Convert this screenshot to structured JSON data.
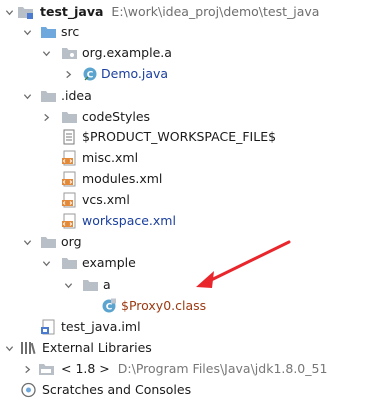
{
  "project": {
    "name": "test_java",
    "path": "E:\\work\\idea_proj\\demo\\test_java"
  },
  "tree": {
    "src": "src",
    "pkg_org_example_a": "org.example.a",
    "demo_java": "Demo.java",
    "idea": ".idea",
    "codeStyles": "codeStyles",
    "product_ws": "$PRODUCT_WORKSPACE_FILE$",
    "misc": "misc.xml",
    "modules": "modules.xml",
    "vcs": "vcs.xml",
    "workspace": "workspace.xml",
    "org": "org",
    "example": "example",
    "a": "a",
    "proxy_class": "$Proxy0.class",
    "iml": "test_java.iml",
    "external_libraries": "External Libraries",
    "jdk": "< 1.8 >",
    "jdk_path": "D:\\Program Files\\Java\\jdk1.8.0_51",
    "scratches": "Scratches and Consoles"
  },
  "colors": {
    "folder": "#b9bfc6",
    "source_folder": "#6fa8dc",
    "java_class": "#5ba4cf",
    "xml_icon": "#e38a3a",
    "annotation_arrow": "#e8262c",
    "modified_file": "#1b3f9e",
    "new_file": "#9b3a12"
  }
}
